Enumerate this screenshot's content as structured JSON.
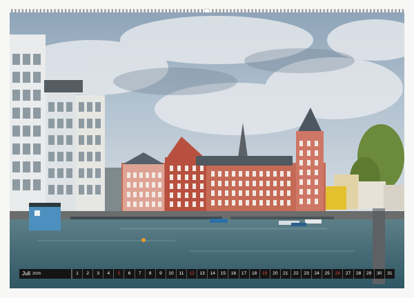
{
  "calendar": {
    "month": "Juli",
    "year": "2026",
    "days": [
      {
        "n": "1",
        "sunday": false
      },
      {
        "n": "2",
        "sunday": false
      },
      {
        "n": "3",
        "sunday": false
      },
      {
        "n": "4",
        "sunday": false
      },
      {
        "n": "5",
        "sunday": true
      },
      {
        "n": "6",
        "sunday": false
      },
      {
        "n": "7",
        "sunday": false
      },
      {
        "n": "8",
        "sunday": false
      },
      {
        "n": "9",
        "sunday": false
      },
      {
        "n": "10",
        "sunday": false
      },
      {
        "n": "11",
        "sunday": false
      },
      {
        "n": "12",
        "sunday": true
      },
      {
        "n": "13",
        "sunday": false
      },
      {
        "n": "14",
        "sunday": false
      },
      {
        "n": "15",
        "sunday": false
      },
      {
        "n": "16",
        "sunday": false
      },
      {
        "n": "17",
        "sunday": false
      },
      {
        "n": "18",
        "sunday": false
      },
      {
        "n": "19",
        "sunday": true
      },
      {
        "n": "20",
        "sunday": false
      },
      {
        "n": "21",
        "sunday": false
      },
      {
        "n": "22",
        "sunday": false
      },
      {
        "n": "23",
        "sunday": false
      },
      {
        "n": "24",
        "sunday": false
      },
      {
        "n": "25",
        "sunday": false
      },
      {
        "n": "26",
        "sunday": true
      },
      {
        "n": "27",
        "sunday": false
      },
      {
        "n": "28",
        "sunday": false
      },
      {
        "n": "29",
        "sunday": false
      },
      {
        "n": "30",
        "sunday": false
      },
      {
        "n": "31",
        "sunday": false
      }
    ]
  },
  "colors": {
    "sunday": "#e0463a",
    "bar_bg": "#151515",
    "sky": "#9fb4c8",
    "water": "#3f6b78",
    "brick": "#b34a3a"
  },
  "icons": {
    "binding": "wire-binding-icon",
    "hanger": "hanger-hole-icon"
  }
}
